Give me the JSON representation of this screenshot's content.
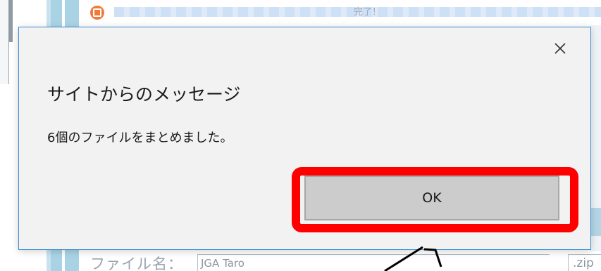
{
  "background": {
    "progress_text": "完了！",
    "filename_label": "ファイル名：",
    "filename_value": "JGA  Taro",
    "extension": ".zip"
  },
  "dialog": {
    "title": "サイトからのメッセージ",
    "message": "6個のファイルをまとめました。",
    "ok_label": "OK",
    "close_icon": "close-icon"
  },
  "annotation": {
    "highlight_color": "#ff0000",
    "arrow_color": "#000000"
  },
  "colors": {
    "dialog_border": "#3c8bd2",
    "dialog_bg": "#f2f2f2",
    "button_bg": "#cccccc",
    "status_icon": "#f07a3c"
  }
}
